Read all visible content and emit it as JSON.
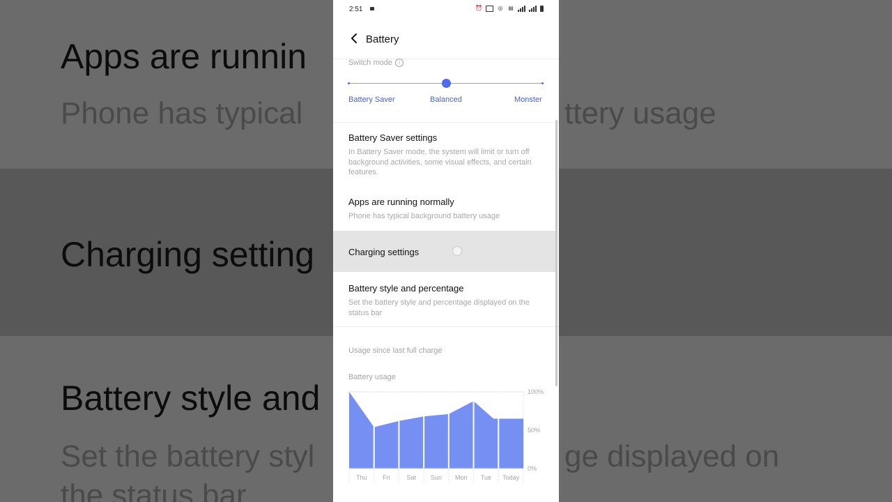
{
  "background": {
    "title_1": "Apps are runnin",
    "subtitle_1": "Phone has typical",
    "subtitle_1b": "ttery usage",
    "title_2": "Charging setting",
    "title_3": "Battery style and",
    "subtitle_3": "Set the battery styl",
    "subtitle_3b": "ge displayed on",
    "subtitle_3c": "the status bar"
  },
  "status_bar": {
    "time": "2:51"
  },
  "header": {
    "title": "Battery"
  },
  "switch_mode": {
    "label": "Switch mode",
    "options": [
      "Battery Saver",
      "Balanced",
      "Monster"
    ],
    "selected": "Balanced"
  },
  "settings": {
    "battery_saver": {
      "title": "Battery Saver settings",
      "desc": "In Battery Saver mode, the system will limit or turn off background activities, some visual effects, and certain features."
    },
    "apps_running": {
      "title": "Apps are running normally",
      "desc": "Phone has typical background battery usage"
    },
    "charging": {
      "title": "Charging settings"
    },
    "battery_style": {
      "title": "Battery style and percentage",
      "desc": "Set the battery style and percentage displayed on the status bar"
    }
  },
  "usage": {
    "section_label": "Usage since last full charge",
    "chart_label": "Battery usage"
  },
  "colors": {
    "accent": "#4a6bef",
    "chart_fill": "#7590f2"
  },
  "chart_data": {
    "type": "area",
    "categories": [
      "Thu",
      "Fri",
      "Sat",
      "Sun",
      "Mon",
      "Tue",
      "Today"
    ],
    "x_ticks": [
      "Thu",
      "Fri",
      "Sat",
      "Sun",
      "Mon",
      "Tue",
      "Today"
    ],
    "y_ticks": [
      "100%",
      "50%",
      "0%"
    ],
    "points": [
      {
        "x": 0.0,
        "y": 100
      },
      {
        "x": 1.0,
        "y": 54
      },
      {
        "x": 2.0,
        "y": 62
      },
      {
        "x": 3.0,
        "y": 68
      },
      {
        "x": 4.0,
        "y": 71
      },
      {
        "x": 5.0,
        "y": 88
      },
      {
        "x": 5.8,
        "y": 65
      },
      {
        "x": 7.0,
        "y": 65
      }
    ],
    "ylim": [
      0,
      100
    ],
    "grid": true
  }
}
